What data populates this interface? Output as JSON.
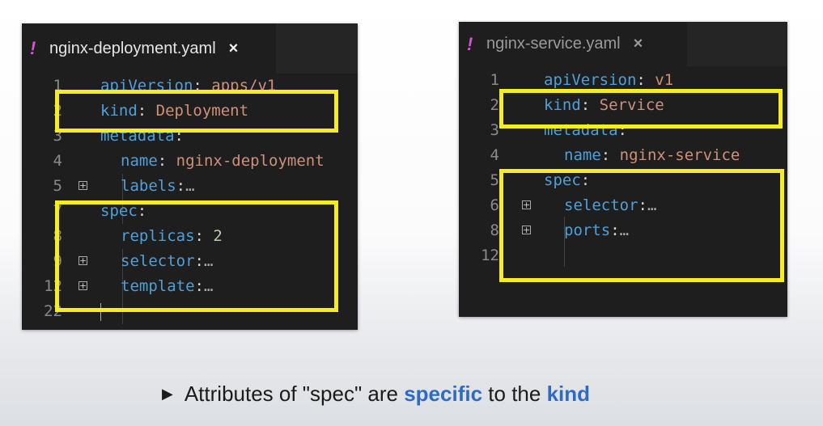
{
  "left_editor": {
    "tab": {
      "icon": "yaml-file-icon",
      "title": "nginx-deployment.yaml",
      "close": "×"
    },
    "lines": [
      {
        "num": "1",
        "key": "apiVersion",
        "value": "apps/v1"
      },
      {
        "num": "2",
        "key": "kind",
        "value": "Deployment"
      },
      {
        "num": "3",
        "key": "metadata",
        "value": ""
      },
      {
        "num": "4",
        "key": "name",
        "value": "nginx-deployment"
      },
      {
        "num": "5",
        "key": "labels",
        "value": "…",
        "folded": true
      },
      {
        "num": "7",
        "key": "spec",
        "value": ""
      },
      {
        "num": "8",
        "key": "replicas",
        "value": "2"
      },
      {
        "num": "9",
        "key": "selector",
        "value": "…",
        "folded": true
      },
      {
        "num": "12",
        "key": "template",
        "value": "…",
        "folded": true
      },
      {
        "num": "22",
        "key": "",
        "value": ""
      }
    ]
  },
  "right_editor": {
    "tab": {
      "icon": "yaml-file-icon",
      "title": "nginx-service.yaml",
      "close": "×"
    },
    "lines": [
      {
        "num": "1",
        "key": "apiVersion",
        "value": "v1"
      },
      {
        "num": "2",
        "key": "kind",
        "value": "Service"
      },
      {
        "num": "3",
        "key": "metadata",
        "value": ""
      },
      {
        "num": "4",
        "key": "name",
        "value": "nginx-service"
      },
      {
        "num": "5",
        "key": "spec",
        "value": ""
      },
      {
        "num": "6",
        "key": "selector",
        "value": "…",
        "folded": true
      },
      {
        "num": "8",
        "key": "ports",
        "value": "…",
        "folded": true
      },
      {
        "num": "12",
        "key": "",
        "value": ""
      }
    ]
  },
  "caption": {
    "bullet": "▶",
    "before": "Attributes of \"spec\" are",
    "highlight1": "specific",
    "middle": "to the",
    "highlight2": "kind"
  },
  "colors": {
    "editor_bg": "#1e1e1e",
    "highlight_box": "#f5ec21",
    "yaml_key": "#4fa0d8",
    "yaml_string": "#ce9178",
    "yaml_number": "#b5cea8",
    "caption_accent": "#2f6bc2"
  }
}
